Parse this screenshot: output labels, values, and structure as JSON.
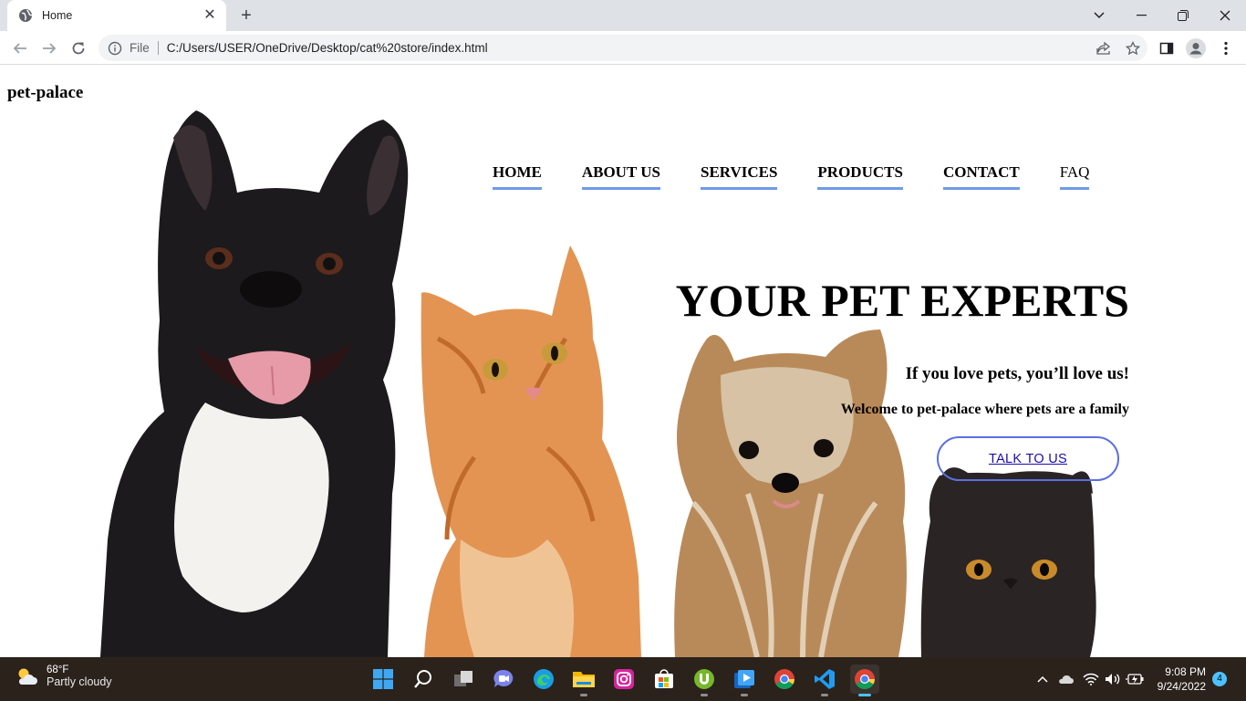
{
  "browser": {
    "tab_title": "Home",
    "file_label": "File",
    "url": "C:/Users/USER/OneDrive/Desktop/cat%20store/index.html"
  },
  "site": {
    "logo": "pet-palace",
    "nav": [
      "HOME",
      "ABOUT US",
      "SERVICES",
      "PRODUCTS",
      "CONTACT",
      "FAQ"
    ],
    "headline": "YOUR PET EXPERTS",
    "tagline": "If you love pets, you’ll love us!",
    "welcome": "Welcome to pet-palace where pets are a family",
    "cta": "TALK TO US",
    "accent_color": "#6f9be8"
  },
  "taskbar": {
    "temperature": "68°F",
    "condition": "Partly cloudy",
    "time": "9:08 PM",
    "date": "9/24/2022",
    "notification_count": "4",
    "apps": [
      "start-icon",
      "search-icon",
      "task-view-icon",
      "chat-icon",
      "edge-icon",
      "file-explorer-icon",
      "instagram-icon",
      "store-icon",
      "utorrent-icon",
      "media-player-icon",
      "chrome-icon",
      "vscode-icon",
      "chrome-icon"
    ]
  }
}
